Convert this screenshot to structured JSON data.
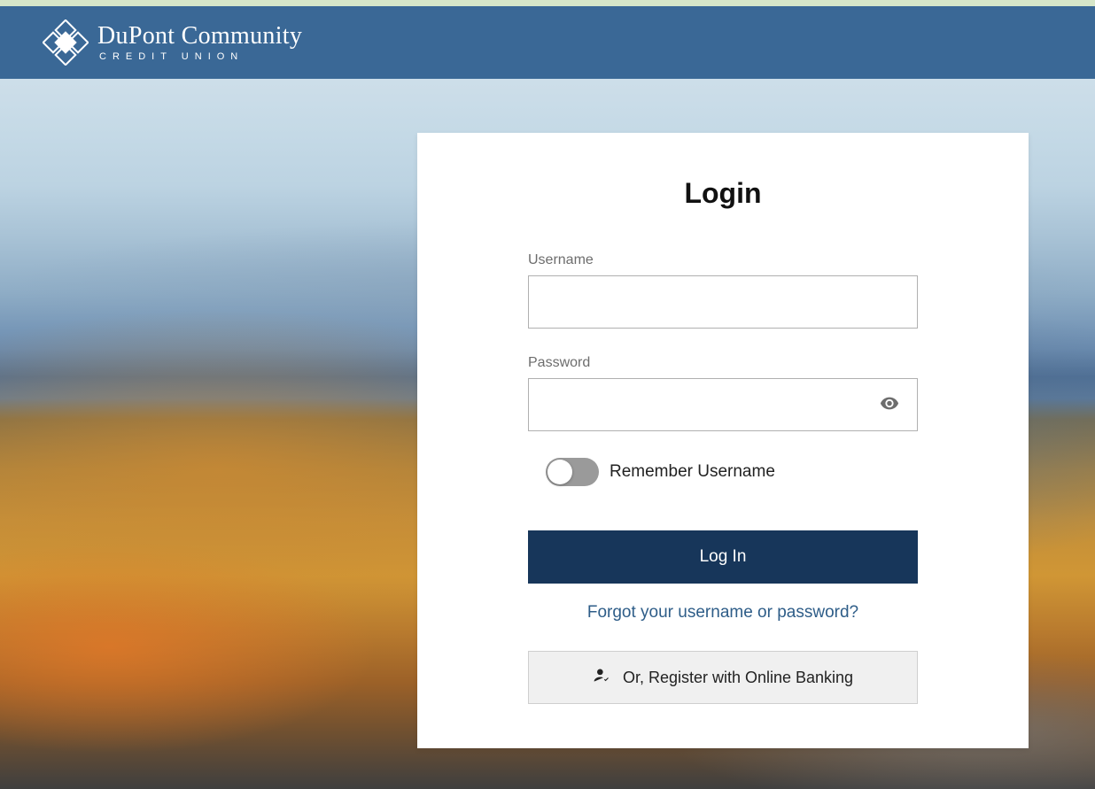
{
  "brand": {
    "name_line1": "DuPont Community",
    "name_line2": "CREDIT UNION"
  },
  "login": {
    "heading": "Login",
    "username_label": "Username",
    "username_value": "",
    "password_label": "Password",
    "password_value": "",
    "remember_label": "Remember Username",
    "remember_checked": false,
    "submit_label": "Log In",
    "forgot_label": "Forgot your username or password?",
    "register_label": "Or, Register with Online Banking"
  },
  "colors": {
    "header_bg": "#3a6896",
    "primary_button": "#17365a",
    "link": "#2e5d88"
  }
}
